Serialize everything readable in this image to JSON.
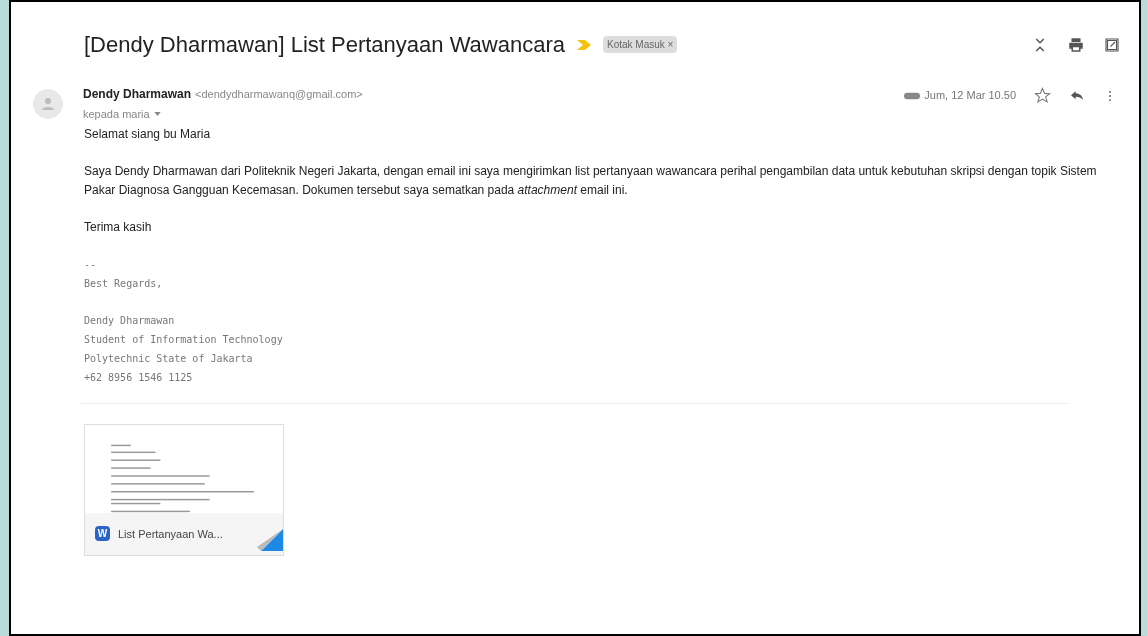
{
  "subject": "[Dendy Dharmawan] List Pertanyaan Wawancara",
  "label": {
    "text": "Kotak Masuk",
    "remove": "×"
  },
  "sender": {
    "name": "Dendy Dharmawan",
    "email": "<dendydharmawanq@gmail.com>",
    "recipient": "kepada maria",
    "date": "Jum, 12 Mar 10.50",
    "starred": false
  },
  "body": [
    {
      "kind": "text",
      "text": "Selamat siang bu Maria"
    },
    {
      "kind": "text",
      "text": "Saya Dendy Dharmawan dari Politeknik Negeri Jakarta, dengan email ini saya mengirimkan list pertanyaan wawancara perihal pengambilan data untuk kebutuhan skripsi dengan topik Sistem Pakar Diagnosa Gangguan Kecemasan. Dokumen tersebut saya sematkan pada *attachment* email ini."
    },
    {
      "kind": "text",
      "text": "Terima kasih"
    },
    {
      "kind": "signature",
      "lines": [
        "--",
        "Best Regards,"
      ]
    },
    {
      "kind": "signature",
      "lines": [
        "Dendy Dharmawan",
        "Student of Information Technology",
        "Polytechnic State of Jakarta",
        "+62 8956 1546 1125"
      ]
    }
  ],
  "attachment": {
    "file_badge": "W",
    "name": "List Pertanyaan Wa..."
  }
}
